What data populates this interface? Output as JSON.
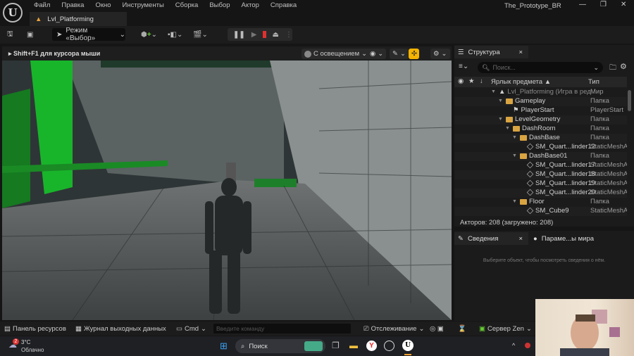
{
  "app": {
    "logo": "U",
    "menu": [
      "Файл",
      "Правка",
      "Окно",
      "Инструменты",
      "Сборка",
      "Выбор",
      "Актор",
      "Справка"
    ],
    "level_tab": "Lvl_Platforming",
    "project": "The_Prototype_BR",
    "window_controls": [
      "—",
      "❐",
      "✕"
    ]
  },
  "toolbar": {
    "mode": "Режим «Выбор»",
    "icons": [
      "save-icon",
      "browse-icon",
      "add-actor-icon",
      "blueprint-icon",
      "cinematics-icon",
      "pause-icon",
      "skip-icon",
      "stop-icon",
      "eject-icon"
    ]
  },
  "viewport": {
    "hint": "Shift+F1 для курсора мыши",
    "lighting": "С освещением",
    "accent": "#f5b300"
  },
  "outliner": {
    "tab": "Структура",
    "search_placeholder": "Поиск...",
    "col_label": "Ярлык предмета ▲",
    "col_type": "Тип",
    "rows": [
      {
        "name": "Lvl_Platforming (Игра в ред",
        "type": "Мир",
        "level": 0,
        "kind": "world"
      },
      {
        "name": "Gameplay",
        "type": "Папка",
        "level": 1,
        "kind": "folder"
      },
      {
        "name": "PlayerStart",
        "type": "PlayerStart",
        "level": 2,
        "kind": "flag"
      },
      {
        "name": "LevelGeometry",
        "type": "Папка",
        "level": 1,
        "kind": "folder"
      },
      {
        "name": "DashRoom",
        "type": "Папка",
        "level": 2,
        "kind": "folder"
      },
      {
        "name": "DashBase",
        "type": "Папка",
        "level": 3,
        "kind": "folder"
      },
      {
        "name": "SM_Quart...linder12",
        "type": "StaticMeshA",
        "level": 4,
        "kind": "mesh"
      },
      {
        "name": "DashBase01",
        "type": "Папка",
        "level": 3,
        "kind": "folder"
      },
      {
        "name": "SM_Quart...linder17",
        "type": "StaticMeshA",
        "level": 4,
        "kind": "mesh"
      },
      {
        "name": "SM_Quart...linder18",
        "type": "StaticMeshA",
        "level": 4,
        "kind": "mesh"
      },
      {
        "name": "SM_Quart...linder19",
        "type": "StaticMeshA",
        "level": 4,
        "kind": "mesh"
      },
      {
        "name": "SM_Quart...linder20",
        "type": "StaticMeshA",
        "level": 4,
        "kind": "mesh"
      },
      {
        "name": "Floor",
        "type": "Папка",
        "level": 3,
        "kind": "folder"
      },
      {
        "name": "SM_Cube9",
        "type": "StaticMeshA",
        "level": 4,
        "kind": "mesh"
      }
    ],
    "actors": "Акторов: 208 (загружено: 208)"
  },
  "details": {
    "tab": "Сведения",
    "tab2": "Параме...ы мира",
    "empty": "Выберите объект, чтобы посмотреть сведения о нём."
  },
  "bottombar": {
    "content": "Панель ресурсов",
    "log": "Журнал выходных данных",
    "cmd": "Cmd",
    "cmd_placeholder": "Введите команду",
    "trace": "Отслеживание",
    "zen": "Сервер Zen"
  },
  "taskbar": {
    "temp": "3°C",
    "weather": "Облачно",
    "badge": "2",
    "search": "Поиск"
  }
}
